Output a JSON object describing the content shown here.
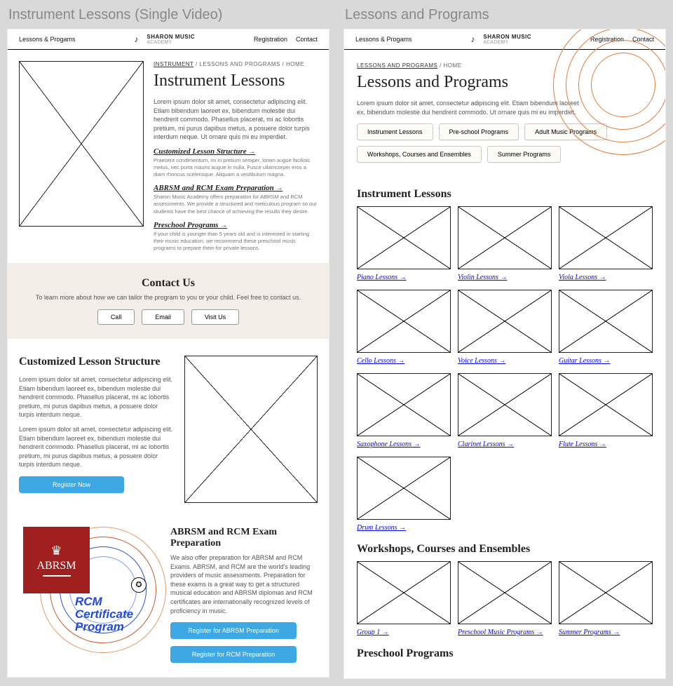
{
  "left": {
    "title": "Instrument Lessons (Single Video)",
    "nav": {
      "left": "Lessons & Progams",
      "brand_top": "SHARON MUSIC",
      "brand_sub": "ACADEMY",
      "reg": "Registration",
      "contact": "Contact"
    },
    "crumbs": {
      "a": "INSTRUMENT",
      "b": "LESSONS AND PROGRAMS",
      "c": "HOME"
    },
    "h1": "Instrument Lessons",
    "intro": "Lorem ipsum dolor sit amet, consectetur adipiscing elit. Etiam bibendum laoreet ex, bibendum molestie dui hendrerit commodo. Phasellus placerat, mi ac lobortis pretium, mi purus dapibus metus, a posuere dolor turpis interdum neque. Ut ornare quis mi eu imperdiet.",
    "sub1": {
      "title": "Customized Lesson Structure",
      "body": "Praesent condimentum, mi in pretium semper, lorem augue facilisis metus, nec porta mauris augue in nulla. Fusce ullamcorper eros a diam rhoncus scelerisque. Aliquam a vestibulum magna."
    },
    "sub2": {
      "title": "ABRSM and RCM Exam Preparation",
      "body": "Sharon Music Academy offers preparation for ABRSM and RCM assessments. We provide a structured and meticulous program so our students have the best chance of achieving the results they desire."
    },
    "sub3": {
      "title": "Preschool Programs",
      "body": "If your child is younger than 5 years old and is interested in starting their music education, we recommend these preschool music programs to prepare them for private lessons."
    },
    "contact": {
      "title": "Contact Us",
      "body": "To learn more about how we can tailor the program to you or your child. Feel free to contact us.",
      "call": "Call",
      "email": "Email",
      "visit": "Visit Us"
    },
    "custom": {
      "title": "Customized Lesson Structure",
      "p1": "Lorem ipsum dolor sit amet, consectetur adipiscing elit. Etiam bibendum laoreet ex, bibendum molestie dui hendrerit commodo. Phasellus placerat, mi ac lobortis pretium, mi purus dapibus metus, a posuere dolor turpis interdum neque.",
      "p2": "Lorem ipsum dolor sit amet, consectetur adipiscing elit. Etiam bibendum laoreet ex, bibendum molestie dui hendrerit commodo. Phasellus placerat, mi ac lobortis pretium, mi purus dapibus metus, a posuere dolor turpis interdum neque.",
      "btn": "Register Now"
    },
    "abrsm": {
      "title": "ABRSM and RCM Exam Preparation",
      "body": "We also offer preparation for ABRSM and RCM Exams. ABRSM, and RCM are the world's leading providers of music assessments. Preparation for these exams is a great way to get a structured musical education and ABRSM diplomas and RCM certificates are internationally recognized levels of proficiency in music.",
      "btn1": "Register for ABRSM Preparation",
      "btn2": "Register for RCM Preparation",
      "sq": "ABRSM",
      "rcm_l1": "RCM",
      "rcm_l2": "Certificate",
      "rcm_l3": "Program"
    }
  },
  "right": {
    "title": "Lessons and Programs",
    "nav": {
      "left": "Lessons & Progams",
      "brand_top": "SHARON MUSIC",
      "brand_sub": "ACADEMY",
      "reg": "Registration",
      "contact": "Contact"
    },
    "crumbs": {
      "a": "LESSONS AND PROGRAMS",
      "b": "HOME"
    },
    "h1": "Lessons and Programs",
    "intro": "Lorem ipsum dolor sit amet, consectetur adipiscing elit. Etiam bibendum laoreet ex, bibendum molestie dui hendrerit commodo. Ut ornare quis mi eu imperdiet.",
    "pills": [
      "Instrument Lessons",
      "Pre-school Programs",
      "Adult Music Programs",
      "Workshops, Courses and Ensembles",
      "Summer Programs"
    ],
    "sec1": "Instrument Lessons",
    "lessons": [
      "Piano Lessons",
      "Violin Lessons",
      "Viola Lessons",
      "Cello Lessons",
      "Voice Lessons",
      "Guitar Lessons",
      "Saxophone Lessons",
      "Clarinet Lessons",
      "Flute Lessons",
      "Drum Lessons"
    ],
    "sec2": "Workshops, Courses and Ensembles",
    "workshops": [
      "Group 1",
      "Preschool Music Programs",
      "Summer Programs"
    ],
    "sec3": "Preschool Programs"
  }
}
